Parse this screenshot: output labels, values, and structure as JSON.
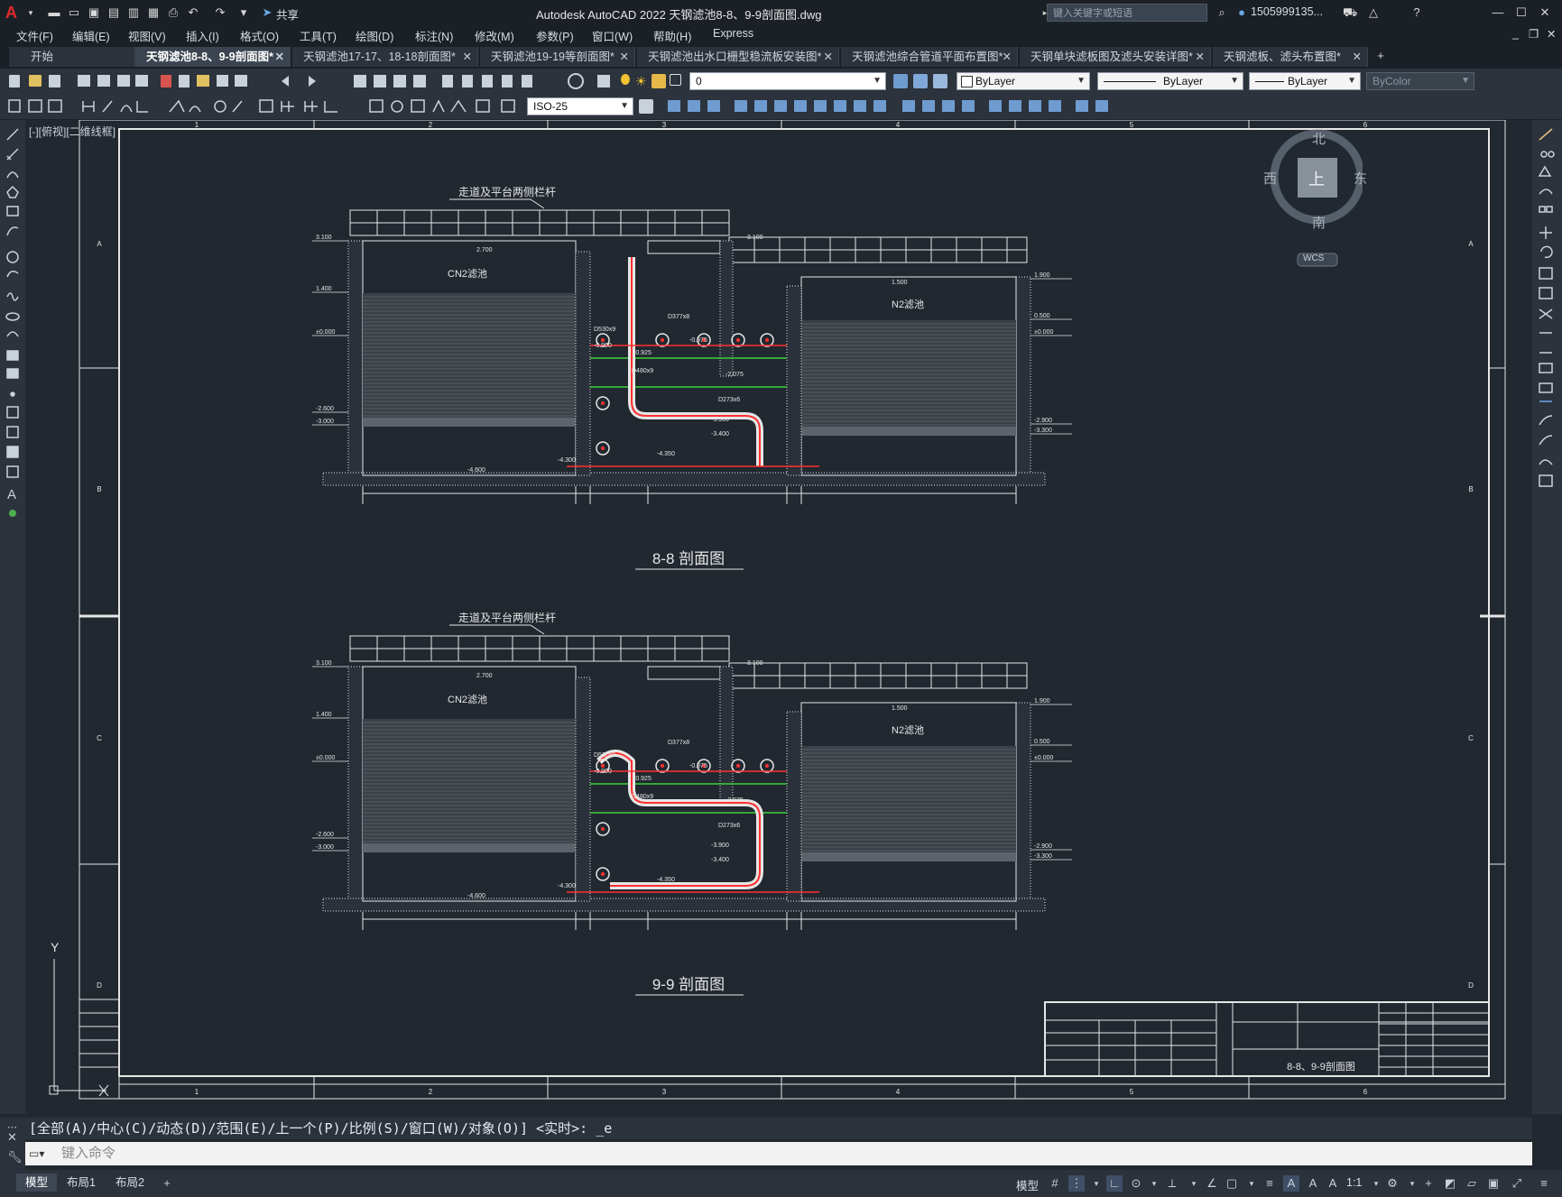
{
  "window": {
    "title": "Autodesk AutoCAD 2022    天钢滤池8-8、9-9剖面图.dwg",
    "search_placeholder": "键入关键字或短语",
    "user": "1505999135...",
    "share_label": "共享"
  },
  "menu": [
    "文件(F)",
    "编辑(E)",
    "视图(V)",
    "插入(I)",
    "格式(O)",
    "工具(T)",
    "绘图(D)",
    "标注(N)",
    "修改(M)",
    "参数(P)",
    "窗口(W)",
    "帮助(H)",
    "Express"
  ],
  "tabs": [
    {
      "label": "开始",
      "active": false,
      "close": false
    },
    {
      "label": "天钢滤池8-8、9-9剖面图*",
      "active": true,
      "close": true
    },
    {
      "label": "天钢滤池17-17、18-18剖面图*",
      "active": false,
      "close": true
    },
    {
      "label": "天钢滤池19-19等剖面图*",
      "active": false,
      "close": true
    },
    {
      "label": "天钢滤池出水口栅型稳流板安装图*",
      "active": false,
      "close": true
    },
    {
      "label": "天钢滤池综合管道平面布置图*",
      "active": false,
      "close": true
    },
    {
      "label": "天钢单块滤板图及滤头安装详图*",
      "active": false,
      "close": true
    },
    {
      "label": "天钢滤板、滤头布置图*",
      "active": false,
      "close": true
    }
  ],
  "properties": {
    "layer": "0",
    "color": "ByLayer",
    "linetype": "ByLayer",
    "lineweight": "ByLayer",
    "plotstyle": "ByColor",
    "dimstyle": "ISO-25"
  },
  "viewport": {
    "label": "[-][俯视][二维线框]",
    "viewcube": {
      "north": "北",
      "south": "南",
      "east": "东",
      "west": "西",
      "top": "上",
      "wcs": "WCS"
    }
  },
  "drawing": {
    "section1": {
      "title": "8-8 剖面图",
      "railing": "走道及平台两侧栏杆",
      "left_pool": "CN2滤池",
      "right_pool": "N2滤池",
      "elevations_left": [
        "3.100",
        "1.400",
        "±0.000",
        "-2.600",
        "-3.000"
      ],
      "elevations_right": [
        "1.900",
        "0.500",
        "±0.000",
        "-2.900",
        "-3.300"
      ],
      "elevations_center": [
        "2.700",
        "3.100",
        "1.500",
        "-4.600",
        "-4.300"
      ],
      "pipes": [
        "D530x9",
        "D377x8",
        "D273x6",
        "D480x9"
      ],
      "pipe_levels": [
        "-0.900",
        "-0.925",
        "-0.975",
        "-2.075",
        "-3.900",
        "-3.400",
        "-4.350"
      ]
    },
    "section2": {
      "title": "9-9 剖面图",
      "railing": "走道及平台两侧栏杆",
      "left_pool": "CN2滤池",
      "right_pool": "N2滤池",
      "elevations_left": [
        "3.100",
        "1.400",
        "±0.000",
        "-2.600",
        "-3.000"
      ],
      "elevations_right": [
        "1.900",
        "0.500",
        "±0.000",
        "-2.900",
        "-3.300"
      ],
      "elevations_center": [
        "2.700",
        "3.100",
        "1.500",
        "-4.600",
        "-4.300"
      ],
      "pipes": [
        "D530x9",
        "D377x8",
        "D273x6",
        "D480x9"
      ],
      "pipe_levels": [
        "-0.900",
        "-0.925",
        "-0.975",
        "-2.075",
        "-3.900",
        "-3.400",
        "-4.350"
      ]
    },
    "grid_cols": [
      "1",
      "2",
      "3",
      "4",
      "5",
      "6"
    ],
    "grid_rows": [
      "A",
      "B",
      "C",
      "D"
    ],
    "titleblock_name": "8-8、9-9剖面图",
    "axis_y": "Y"
  },
  "command": {
    "history": "[全部(A)/中心(C)/动态(D)/范围(E)/上一个(P)/比例(S)/窗口(W)/对象(O)] <实时>: _e",
    "placeholder": "键入命令"
  },
  "status": {
    "layouts": [
      {
        "label": "模型",
        "active": true
      },
      {
        "label": "布局1",
        "active": false
      },
      {
        "label": "布局2",
        "active": false
      }
    ],
    "model_label": "模型",
    "scale": "1:1"
  }
}
